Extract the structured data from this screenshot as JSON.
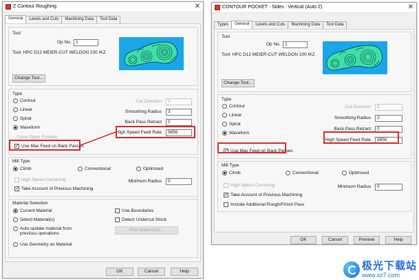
{
  "dialog1": {
    "title": "Z Contour Roughing",
    "tabs": [
      "General",
      "Levels and Cuts",
      "Machining Data",
      "Tool Data"
    ],
    "tool": {
      "group": "Tool",
      "op_no_label": "Op No.",
      "op_no": "1",
      "tool_text": "Tool: HPC D12 MEIER-CUT  WELDON 100 IKZ",
      "change_tool": "Change Tool..."
    },
    "type": {
      "group": "Type",
      "options": [
        "Contour",
        "Linear",
        "Spiral",
        "Waveform"
      ],
      "selected": "Waveform",
      "close_open_pockets": "Close Open Pockets",
      "use_max_feed": "Use Max Feed on Back Passes",
      "cut_direction_label": "Cut Direction",
      "cut_direction": "0",
      "smoothing_radius_label": "Smoothing Radius",
      "smoothing_radius": "3",
      "back_pass_retract_label": "Back Pass Retract",
      "back_pass_retract": "0",
      "hs_feed_label": "High Speed Feed Rate",
      "hs_feed": "9856"
    },
    "mill_type": {
      "group": "Mill Type",
      "options": [
        "Climb",
        "Conventional",
        "Optimised"
      ],
      "selected": "Climb",
      "high_speed_cornering": "High Speed Cornering",
      "take_account": "Take Account of Previous Machining",
      "min_radius_label": "Minimum Radius",
      "min_radius": "0"
    },
    "material": {
      "group": "Material Selection",
      "current": "Current Material",
      "select": "Select Material(s)",
      "auto_update": "Auto-update material from previous operations",
      "use_geometry": "Use Geometry as Material",
      "use_boundaries": "Use Boundaries",
      "detect_undercut": "Detect Undercut Stock",
      "pick_material": "Pick Material(s)..."
    },
    "buttons": [
      "OK",
      "Cancel",
      "Help"
    ]
  },
  "dialog2": {
    "title": "CONTOUR POCKET - Sides : Vertical (Auto Z)",
    "tabs": [
      "Types",
      "General",
      "Levels and Cuts",
      "Machining Data",
      "Tool Data"
    ],
    "tool": {
      "group": "Tool",
      "op_no_label": "Op No.",
      "op_no": "1",
      "tool_text": "Tool: HPC D12 MEIER-CUT  WELDON 100 IKZ",
      "change_tool": "Change Tool..."
    },
    "type": {
      "group": "Type",
      "options": [
        "Contour",
        "Linear",
        "Spiral",
        "Waveform"
      ],
      "selected": "Waveform",
      "use_max_feed": "Use Max Feed on Back Passes",
      "cut_direction_label": "Cut Direction",
      "cut_direction": "0",
      "smoothing_radius_label": "Smoothing Radius",
      "smoothing_radius": "3",
      "back_pass_retract_label": "Back Pass Retract",
      "back_pass_retract": "0",
      "hs_feed_label": "High Speed Feed Rate",
      "hs_feed": "9856"
    },
    "mill_type": {
      "group": "Mill Type",
      "options": [
        "Climb",
        "Conventional",
        "Optimised"
      ],
      "selected": "Climb",
      "high_speed_cornering": "High Speed Cornering",
      "take_account": "Take Account of Previous Machining",
      "include_additional": "Include Additional Rough/Finish Pass",
      "min_radius_label": "Minimum Radius",
      "min_radius": "0"
    },
    "buttons": [
      "OK",
      "Cancel",
      "Preview",
      "Help"
    ]
  },
  "watermark": {
    "brand": "极光下载站",
    "url": "www.xz7.com"
  },
  "colors": {
    "highlight": "#d62828",
    "preview_bg": "#1aa6e8",
    "preview_part": "#3ee0a8"
  }
}
